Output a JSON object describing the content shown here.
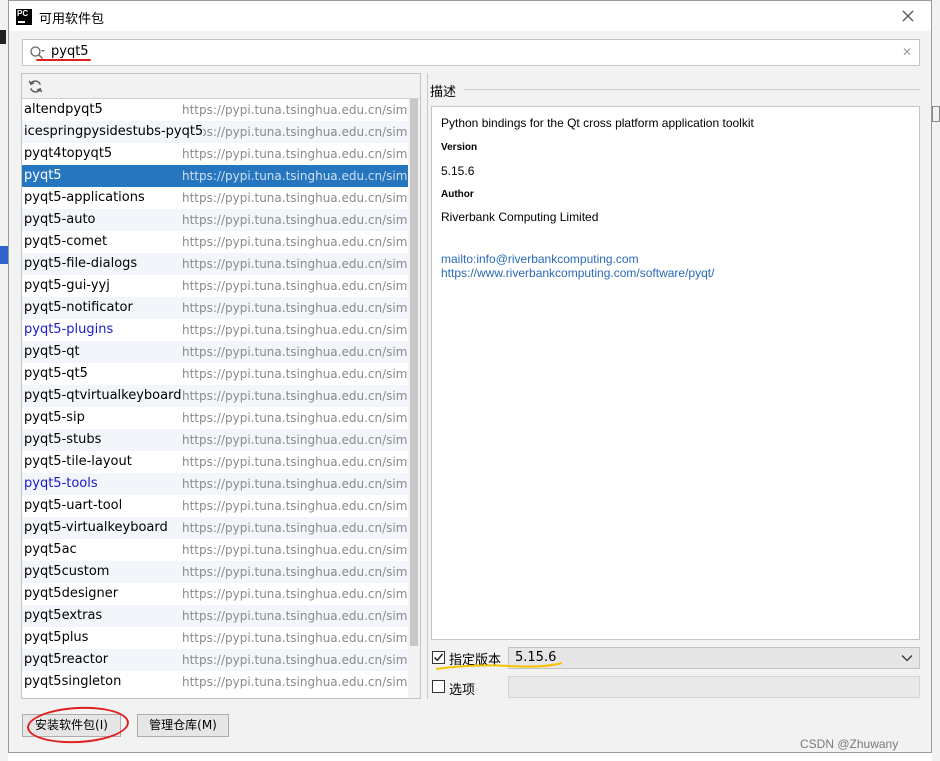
{
  "window": {
    "title": "可用软件包",
    "app_logo": "PC"
  },
  "search": {
    "value": "pyqt5"
  },
  "packages": [
    {
      "name": "altendpyqt5",
      "repo": "https://pypi.tuna.tsinghua.edu.cn/simple/",
      "selected": false,
      "installed": false
    },
    {
      "name": "icespringpysidestubs-pyqt5",
      "repo": "https://pypi.tuna.tsinghua.edu.cn/simple/",
      "selected": false,
      "installed": false
    },
    {
      "name": "pyqt4topyqt5",
      "repo": "https://pypi.tuna.tsinghua.edu.cn/simple/",
      "selected": false,
      "installed": false
    },
    {
      "name": "pyqt5",
      "repo": "https://pypi.tuna.tsinghua.edu.cn/simple/",
      "selected": true,
      "installed": false
    },
    {
      "name": "pyqt5-applications",
      "repo": "https://pypi.tuna.tsinghua.edu.cn/simple/",
      "selected": false,
      "installed": false
    },
    {
      "name": "pyqt5-auto",
      "repo": "https://pypi.tuna.tsinghua.edu.cn/simple/",
      "selected": false,
      "installed": false
    },
    {
      "name": "pyqt5-comet",
      "repo": "https://pypi.tuna.tsinghua.edu.cn/simple/",
      "selected": false,
      "installed": false
    },
    {
      "name": "pyqt5-file-dialogs",
      "repo": "https://pypi.tuna.tsinghua.edu.cn/simple/",
      "selected": false,
      "installed": false
    },
    {
      "name": "pyqt5-gui-yyj",
      "repo": "https://pypi.tuna.tsinghua.edu.cn/simple/",
      "selected": false,
      "installed": false
    },
    {
      "name": "pyqt5-notificator",
      "repo": "https://pypi.tuna.tsinghua.edu.cn/simple/",
      "selected": false,
      "installed": false
    },
    {
      "name": "pyqt5-plugins",
      "repo": "https://pypi.tuna.tsinghua.edu.cn/simple/",
      "selected": false,
      "installed": true
    },
    {
      "name": "pyqt5-qt",
      "repo": "https://pypi.tuna.tsinghua.edu.cn/simple/",
      "selected": false,
      "installed": false
    },
    {
      "name": "pyqt5-qt5",
      "repo": "https://pypi.tuna.tsinghua.edu.cn/simple/",
      "selected": false,
      "installed": false
    },
    {
      "name": "pyqt5-qtvirtualkeyboard",
      "repo": "https://pypi.tuna.tsinghua.edu.cn/simple/",
      "selected": false,
      "installed": false
    },
    {
      "name": "pyqt5-sip",
      "repo": "https://pypi.tuna.tsinghua.edu.cn/simple/",
      "selected": false,
      "installed": false
    },
    {
      "name": "pyqt5-stubs",
      "repo": "https://pypi.tuna.tsinghua.edu.cn/simple/",
      "selected": false,
      "installed": false
    },
    {
      "name": "pyqt5-tile-layout",
      "repo": "https://pypi.tuna.tsinghua.edu.cn/simple/",
      "selected": false,
      "installed": false
    },
    {
      "name": "pyqt5-tools",
      "repo": "https://pypi.tuna.tsinghua.edu.cn/simple/",
      "selected": false,
      "installed": true
    },
    {
      "name": "pyqt5-uart-tool",
      "repo": "https://pypi.tuna.tsinghua.edu.cn/simple/",
      "selected": false,
      "installed": false
    },
    {
      "name": "pyqt5-virtualkeyboard",
      "repo": "https://pypi.tuna.tsinghua.edu.cn/simple/",
      "selected": false,
      "installed": false
    },
    {
      "name": "pyqt5ac",
      "repo": "https://pypi.tuna.tsinghua.edu.cn/simple/",
      "selected": false,
      "installed": false
    },
    {
      "name": "pyqt5custom",
      "repo": "https://pypi.tuna.tsinghua.edu.cn/simple/",
      "selected": false,
      "installed": false
    },
    {
      "name": "pyqt5designer",
      "repo": "https://pypi.tuna.tsinghua.edu.cn/simple/",
      "selected": false,
      "installed": false
    },
    {
      "name": "pyqt5extras",
      "repo": "https://pypi.tuna.tsinghua.edu.cn/simple/",
      "selected": false,
      "installed": false
    },
    {
      "name": "pyqt5plus",
      "repo": "https://pypi.tuna.tsinghua.edu.cn/simple/",
      "selected": false,
      "installed": false
    },
    {
      "name": "pyqt5reactor",
      "repo": "https://pypi.tuna.tsinghua.edu.cn/simple/",
      "selected": false,
      "installed": false
    },
    {
      "name": "pyqt5singleton",
      "repo": "https://pypi.tuna.tsinghua.edu.cn/simple/",
      "selected": false,
      "installed": false
    }
  ],
  "description": {
    "section_label": "描述",
    "summary": "Python bindings for the Qt cross platform application toolkit",
    "version_heading": "Version",
    "version": "5.15.6",
    "author_heading": "Author",
    "author": "Riverbank Computing Limited",
    "links": [
      "mailto:info@riverbankcomputing.com",
      "https://www.riverbankcomputing.com/software/pyqt/"
    ]
  },
  "options": {
    "specify_version_label": "指定版本",
    "specify_version_checked": true,
    "version_selected": "5.15.6",
    "options_label": "选项",
    "options_checked": false,
    "options_value": ""
  },
  "buttons": {
    "install": "安装软件包(I)",
    "manage_repos": "管理仓库(M)"
  },
  "watermark": "CSDN @Zhuwany",
  "colors": {
    "selection": "#2675bf",
    "installed_text": "#1a1acc",
    "link": "#2a6ab8",
    "annotation_red": "#e02020",
    "annotation_yellow": "#f5c400"
  },
  "icons": {
    "search": "search-icon",
    "clear": "clear-icon",
    "refresh": "refresh-icon",
    "close": "close-icon",
    "dropdown": "chevron-down-icon"
  }
}
